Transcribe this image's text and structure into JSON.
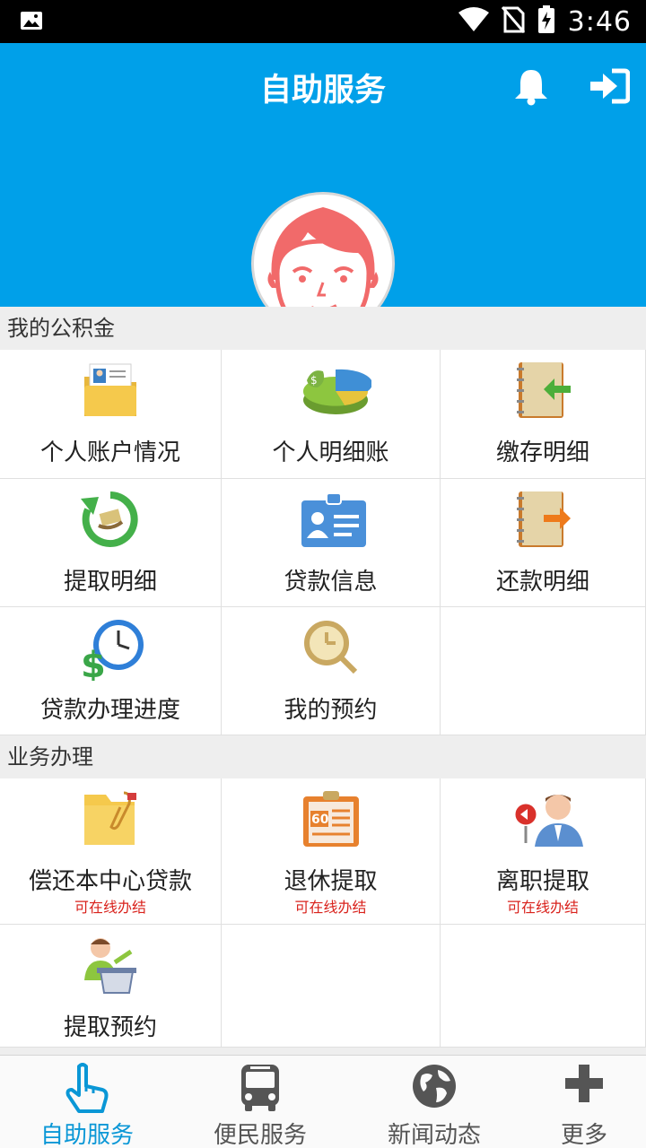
{
  "status_bar": {
    "time": "3:46"
  },
  "header": {
    "title": "自助服务"
  },
  "sections": {
    "fund": {
      "title": "我的公积金",
      "items": [
        {
          "label": "个人账户情况",
          "icon": "folder-id-card-icon"
        },
        {
          "label": "个人明细账",
          "icon": "pie-chart-money-icon"
        },
        {
          "label": "缴存明细",
          "icon": "notebook-arrow-in-icon"
        },
        {
          "label": "提取明细",
          "icon": "refresh-money-icon"
        },
        {
          "label": "贷款信息",
          "icon": "id-card-icon"
        },
        {
          "label": "还款明细",
          "icon": "notebook-arrow-out-icon"
        },
        {
          "label": "贷款办理进度",
          "icon": "clock-dollar-icon"
        },
        {
          "label": "我的预约",
          "icon": "clock-magnifier-icon"
        }
      ]
    },
    "business": {
      "title": "业务办理",
      "items": [
        {
          "label": "偿还本中心贷款",
          "sub": "可在线办结",
          "icon": "folder-clip-icon"
        },
        {
          "label": "退休提取",
          "sub": "可在线办结",
          "icon": "clipboard-60-icon"
        },
        {
          "label": "离职提取",
          "sub": "可在线办结",
          "icon": "person-sign-icon"
        },
        {
          "label": "提取预约",
          "icon": "speaker-podium-icon"
        }
      ]
    }
  },
  "bottom_nav": [
    {
      "label": "自助服务",
      "icon": "hand-pointer-icon",
      "active": true
    },
    {
      "label": "便民服务",
      "icon": "bus-icon",
      "active": false
    },
    {
      "label": "新闻动态",
      "icon": "globe-icon",
      "active": false
    },
    {
      "label": "更多",
      "icon": "plus-icon",
      "active": false
    }
  ],
  "colors": {
    "header": "#00a0e9",
    "active_tab": "#0a97d6",
    "sub_text": "#d9221c"
  }
}
